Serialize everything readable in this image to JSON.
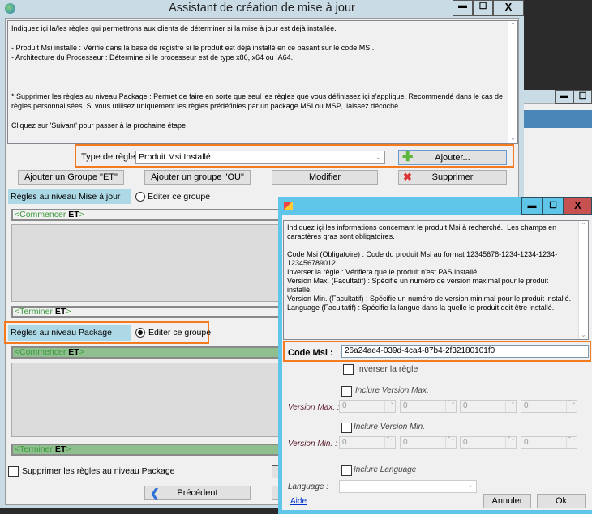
{
  "main": {
    "title": "Assistant de création de mise à jour",
    "window_controls": {
      "minimize": "▬",
      "maximize": "☐",
      "close": "X"
    },
    "description": "Indiquez içi la/les règles qui permettrons aux clients de déterminer si la mise à jour est déjà installée.\n\n- Produit Msi installé : Vérifie dans la base de registre si le produit est déjà installé en ce basant sur le code MSI.\n- Architecture du Processeur : Détermine si le processeur est de type x86, x64 ou IA64.\n\n\n\n* Supprimer les règles au niveau Package : Permet de faire en sorte que seul les règles que vous définissez içi s'applique. Recommendé dans le cas de règles personnalisées. Si vous utilisez uniquement les règles prédéfinies par un package MSI ou MSP,  laissez décoché.\n\nCliquez sur 'Suivant' pour passer à la prochaine étape.",
    "rule_type_label": "Type de règle :",
    "rule_type_value": "Produit Msi Installé",
    "add_button": "Ajouter...",
    "add_and_group": "Ajouter un Groupe \"ET\"",
    "add_or_group": "Ajouter un groupe \"OU\"",
    "modify": "Modifier",
    "delete": "Supprimer",
    "update_group": {
      "label": "Règles au niveau Mise à jour",
      "radio": "Editer ce groupe",
      "start_prefix": "<Commencer ",
      "start_op": "ET",
      "end_prefix": "<Terminer ",
      "end_op": "ET",
      "suffix": ">"
    },
    "package_group": {
      "label": "Règles au niveau Package",
      "radio": "Editer ce groupe",
      "start_prefix": "<Commencer ",
      "start_op": "ET",
      "end_prefix": "<Terminer ",
      "end_op": "ET",
      "suffix": ">"
    },
    "suppress_checkbox": "Supprimer les règles au niveau Package",
    "previous": "Précédent"
  },
  "dialog": {
    "description": "Indiquez içi les informations concernant le produit Msi à recherché.  Les champs en caractères gras sont obligatoires.\n\nCode Msi (Obligatoire) : Code du produit Msi au format 12345678-1234-1234-1234-123456789012\nInverser la règle : Vérifiera que le produit n'est PAS installé.\nVersion Max. (Facultatif) : Spécifie un numéro de version maximal pour le produit installé.\nVersion Min. (Facultatif) : Spécifie un numéro de version minimal pour le produit installé.\nLanguage (Facultatif) : Spécifie la langue dans la quelle le produit doit être installé.",
    "code_label": "Code Msi :",
    "code_value": "26a24ae4-039d-4ca4-87b4-2f32180101f0",
    "invert": "Inverser la règle",
    "include_max": "Inclure Version Max.",
    "max_label": "Version Max. :",
    "max_values": [
      "0",
      "0",
      "0",
      "0"
    ],
    "include_min": "Inclure Version Min.",
    "min_label": "Version Min. :",
    "min_values": [
      "0",
      "0",
      "0",
      "0"
    ],
    "include_lang": "Inclure Language",
    "lang_label": "Language :",
    "lang_value": "",
    "help": "Aide",
    "cancel": "Annuler",
    "ok": "Ok"
  }
}
